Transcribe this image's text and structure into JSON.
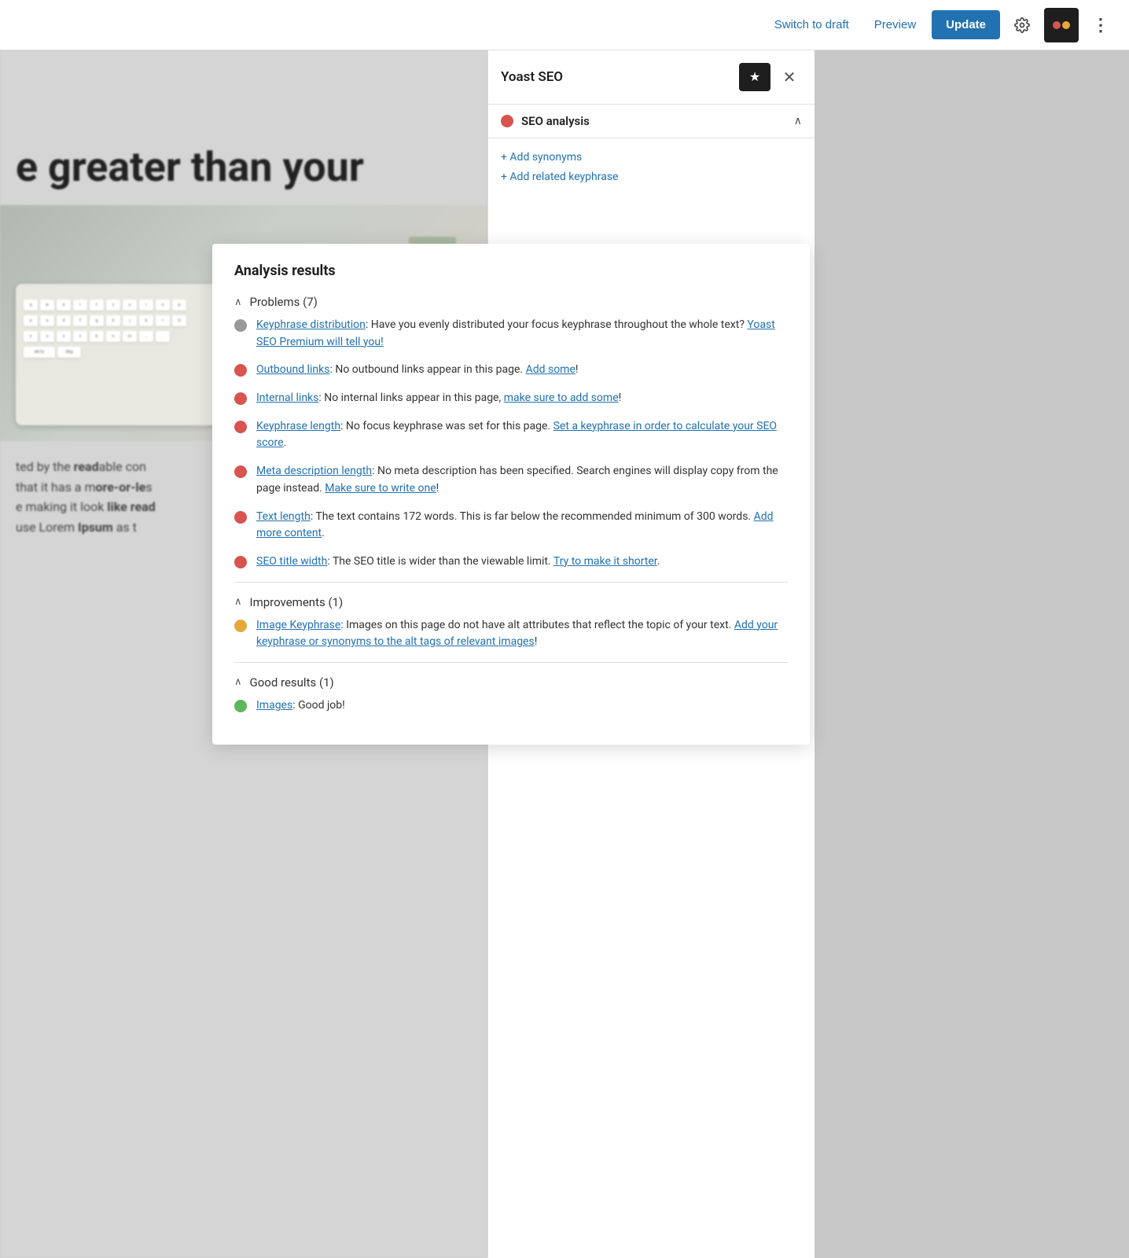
{
  "toolbar": {
    "switch_to_draft": "Switch to draft",
    "preview": "Preview",
    "update": "Update",
    "more_options": "⋮"
  },
  "sidebar": {
    "title": "Yoast SEO",
    "seo_analysis_label": "SEO analysis",
    "add_synonyms": "+ Add synonyms",
    "add_related_keyphrase": "+ Add related keyphrase"
  },
  "editor": {
    "headline": "e greater than your",
    "footer_text1": "ted by the readable con",
    "footer_text2": "that it has a more-or-le",
    "footer_text3": "e making it look like read",
    "footer_text4": "use Lorem Ipsum as t"
  },
  "analysis": {
    "title": "Analysis results",
    "problems_label": "Problems (7)",
    "improvements_label": "Improvements (1)",
    "good_results_label": "Good results (1)",
    "items": {
      "problems": [
        {
          "dot": "gray",
          "link_text": "Keyphrase distribution",
          "text": ": Have you evenly distributed your focus keyphrase throughout the whole text? ",
          "action_link": "Yoast SEO Premium will tell you!",
          "action_href": "#"
        },
        {
          "dot": "red",
          "link_text": "Outbound links",
          "text": ": No outbound links appear in this page. ",
          "action_link": "Add some",
          "action_href": "#",
          "after_action": "!"
        },
        {
          "dot": "red",
          "link_text": "Internal links",
          "text": ": No internal links appear in this page, ",
          "action_link": "make sure to add some",
          "action_href": "#",
          "after_action": "!"
        },
        {
          "dot": "red",
          "link_text": "Keyphrase length",
          "text": ": No focus keyphrase was set for this page. ",
          "action_link": "Set a keyphrase in order to calculate your SEO score",
          "action_href": "#",
          "after_action": "."
        },
        {
          "dot": "red",
          "link_text": "Meta description length",
          "text": ": No meta description has been specified. Search engines will display copy from the page instead. ",
          "action_link": "Make sure to write one",
          "action_href": "#",
          "after_action": "!"
        },
        {
          "dot": "red",
          "link_text": "Text length",
          "text": ": The text contains 172 words. This is far below the recommended minimum of 300 words. ",
          "action_link": "Add more content",
          "action_href": "#",
          "after_action": "."
        },
        {
          "dot": "red",
          "link_text": "SEO title width",
          "text": ": The SEO title is wider than the viewable limit. ",
          "action_link": "Try to make it shorter",
          "action_href": "#",
          "after_action": "."
        }
      ],
      "improvements": [
        {
          "dot": "orange",
          "link_text": "Image Keyphrase",
          "text": ": Images on this page do not have alt attributes that reflect the topic of your text. ",
          "action_link": "Add your keyphrase or synonyms to the alt tags of relevant images",
          "action_href": "#",
          "after_action": "!"
        }
      ],
      "good": [
        {
          "dot": "green",
          "link_text": "Images",
          "text": ": Good job!",
          "action_link": "",
          "action_href": "#"
        }
      ]
    }
  }
}
